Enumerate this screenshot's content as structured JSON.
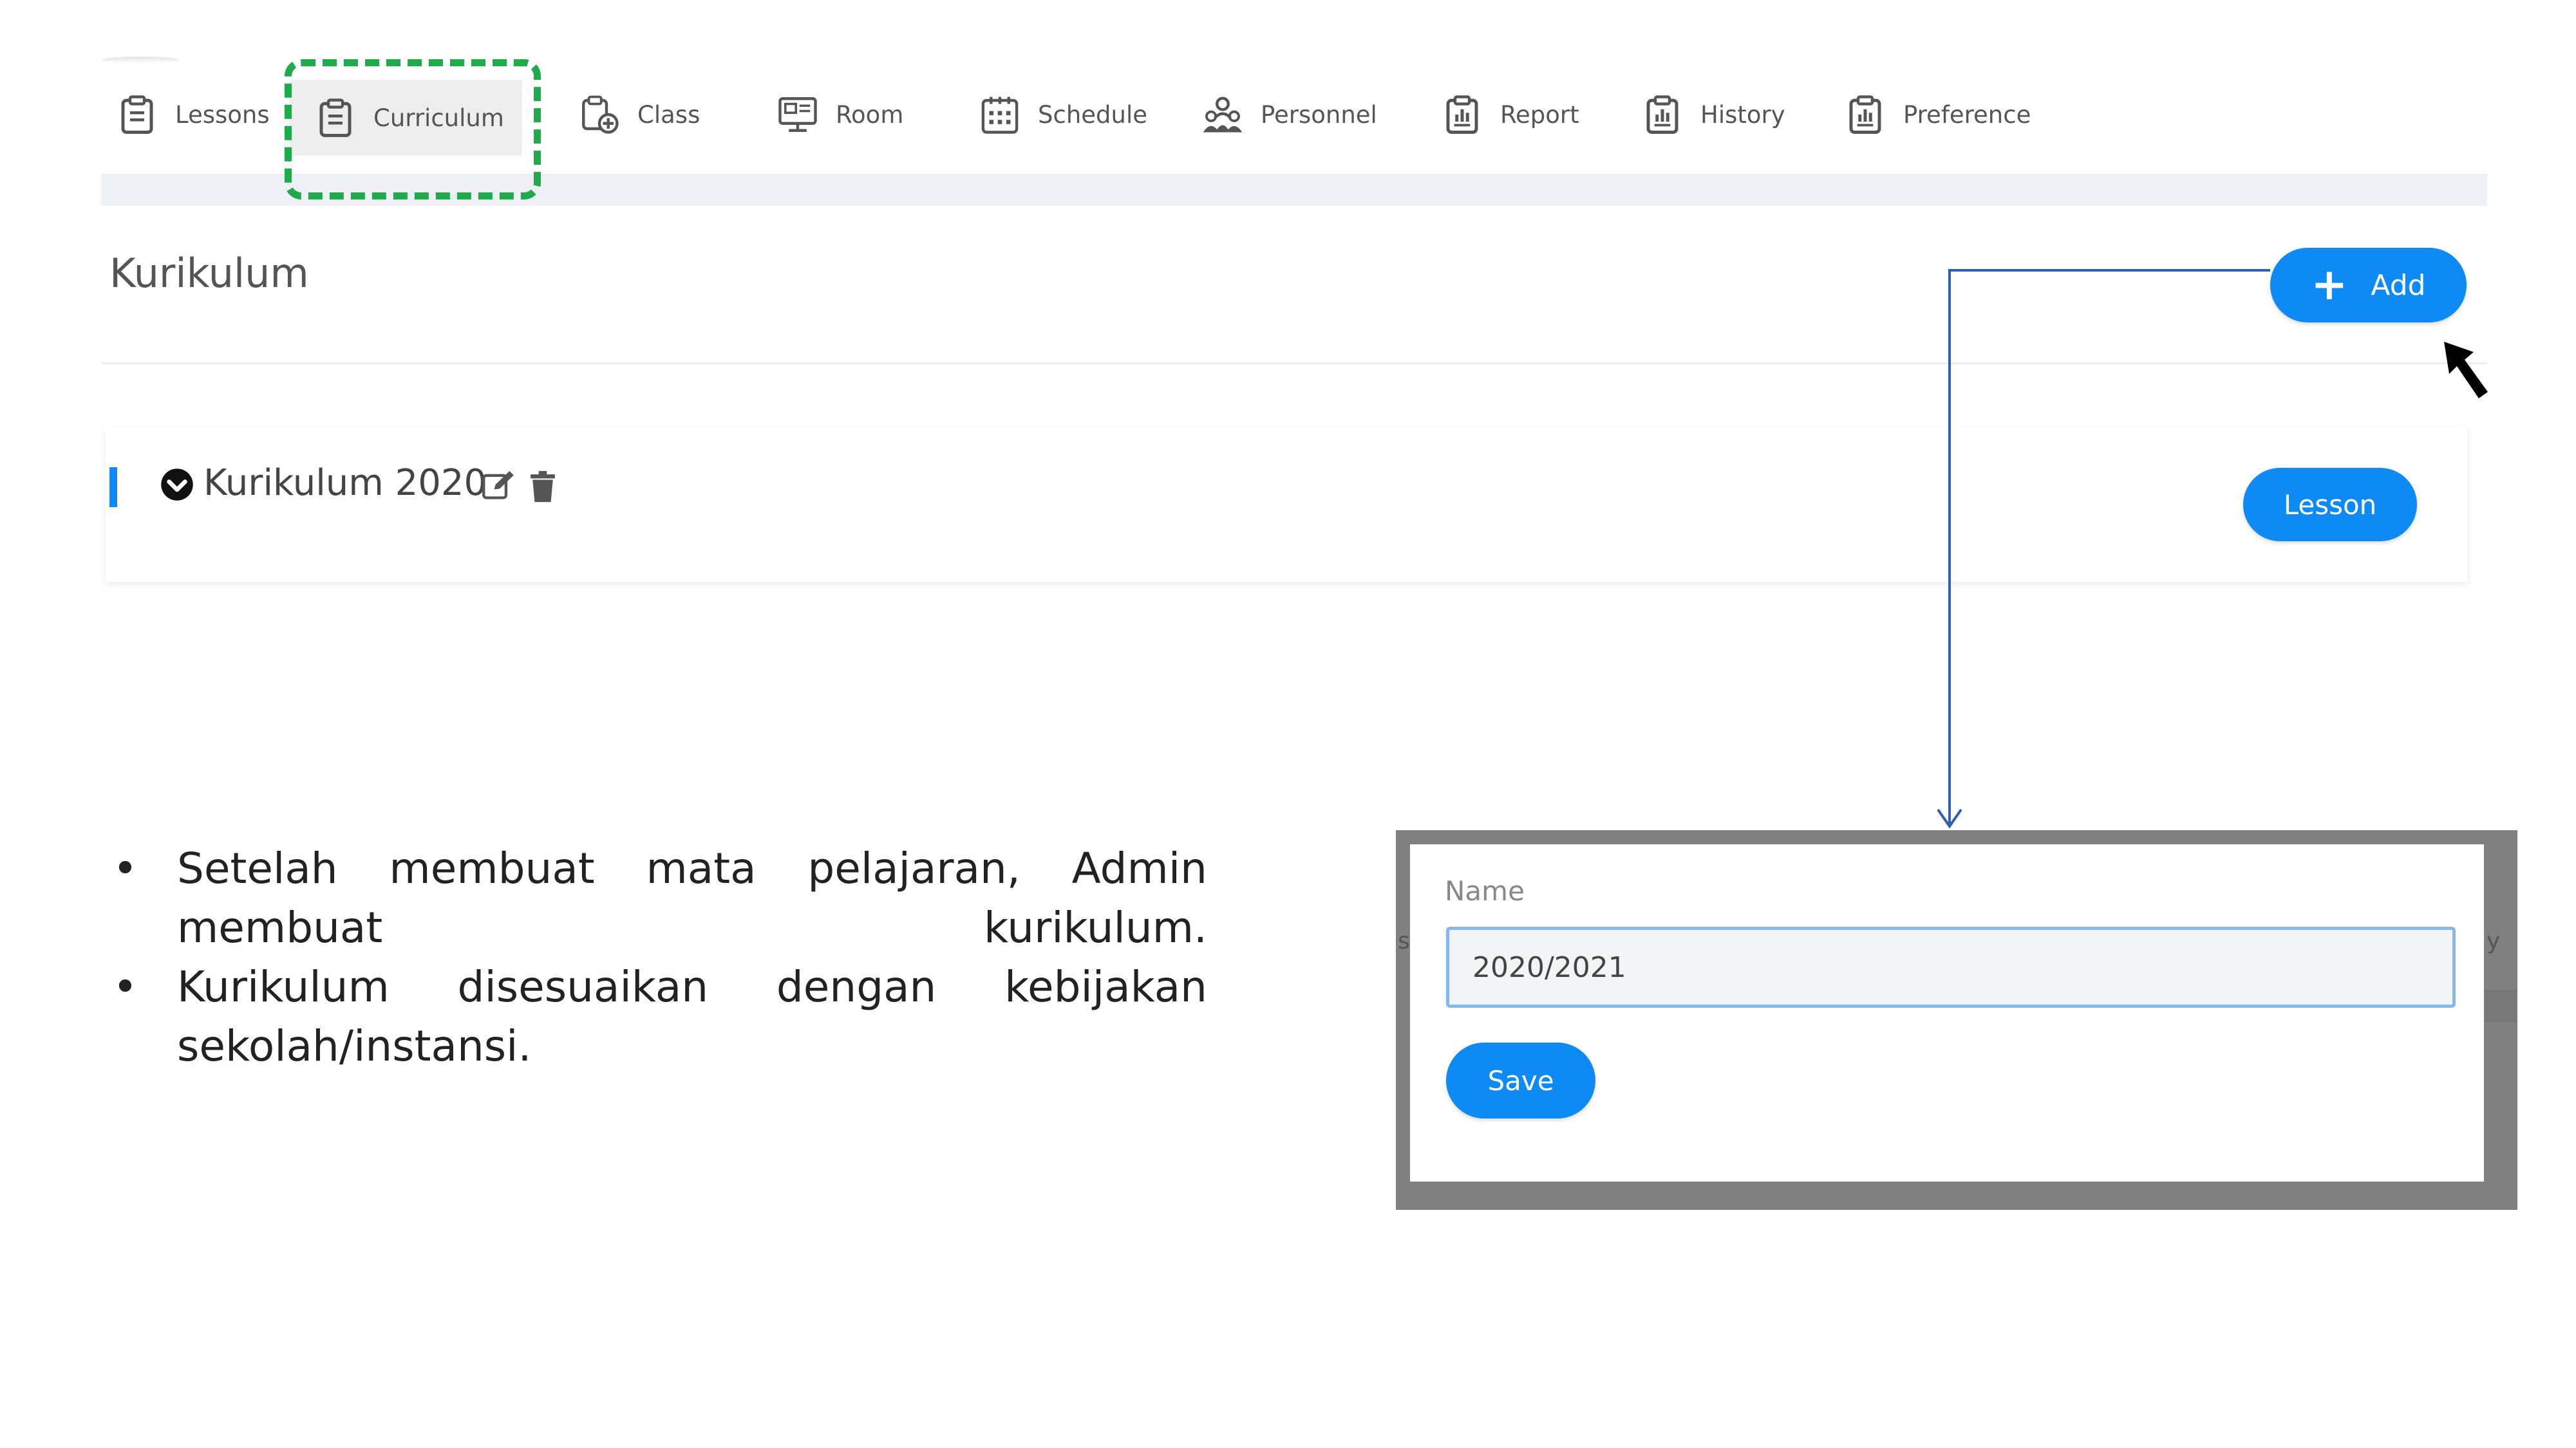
{
  "nav": {
    "items": [
      {
        "label": "Lessons",
        "icon": "clipboard-icon"
      },
      {
        "label": "Curriculum",
        "icon": "clipboard-icon",
        "active": true
      },
      {
        "label": "Class",
        "icon": "clipboard-add-icon"
      },
      {
        "label": "Room",
        "icon": "monitor-icon"
      },
      {
        "label": "Schedule",
        "icon": "calendar-icon"
      },
      {
        "label": "Personnel",
        "icon": "people-icon"
      },
      {
        "label": "Report",
        "icon": "report-icon"
      },
      {
        "label": "History",
        "icon": "history-icon"
      },
      {
        "label": "Preference",
        "icon": "preference-icon"
      }
    ]
  },
  "page": {
    "title": "Kurikulum",
    "add_label": "Add"
  },
  "curriculum": {
    "title": "Kurikulum 2020",
    "lesson_label": "Lesson"
  },
  "bullets": [
    "Setelah membuat mata pelajaran, Admin membuat kurikulum.",
    "Kurikulum disesuaikan dengan kebijakan sekolah/instansi."
  ],
  "modal": {
    "name_label": "Name",
    "name_value": "2020/2021",
    "save_label": "Save",
    "side_left": "s",
    "side_right": "y"
  },
  "colors": {
    "accent": "#0d8af3",
    "highlight": "#1faa4c",
    "connector": "#2f5fb3",
    "modal_frame": "#808080"
  }
}
